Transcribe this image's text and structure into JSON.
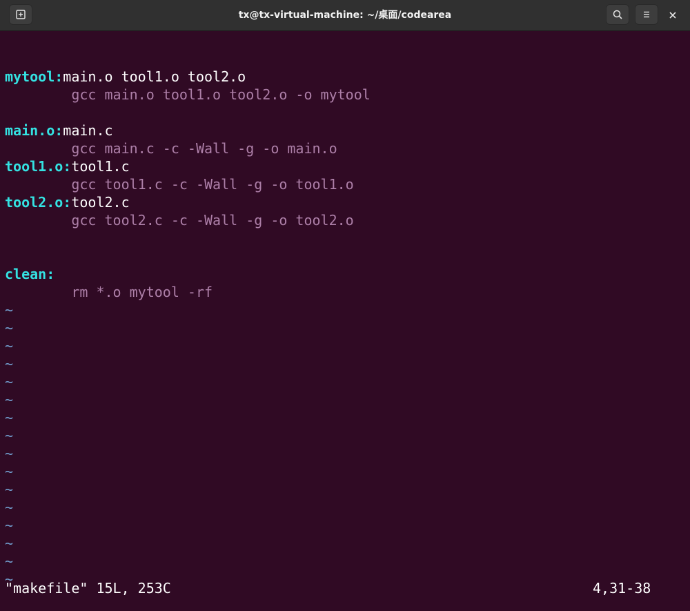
{
  "window": {
    "title": "tx@tx-virtual-machine: ~/桌面/codearea"
  },
  "icons": {
    "new_tab": "new-tab-icon",
    "search": "search-icon",
    "menu": "hamburger-menu-icon",
    "close": "close-icon"
  },
  "editor": {
    "lines": [
      {
        "target": "mytool:",
        "deps": "main.o tool1.o tool2.o"
      },
      {
        "cmd": "        gcc main.o tool1.o tool2.o -o mytool"
      },
      {
        "blank": ""
      },
      {
        "target": "main.o:",
        "deps": "main.c"
      },
      {
        "cmd": "        gcc main.c -c -Wall -g -o main.o"
      },
      {
        "target": "tool1.o:",
        "deps": "tool1.c"
      },
      {
        "cmd": "        gcc tool1.c -c -Wall -g -o tool1.o"
      },
      {
        "target": "tool2.o:",
        "deps": "tool2.c"
      },
      {
        "cmd": "        gcc tool2.c -c -Wall -g -o tool2.o"
      },
      {
        "blank": ""
      },
      {
        "blank": ""
      },
      {
        "target": "clean:",
        "deps": ""
      },
      {
        "cmd": "        rm *.o mytool -rf"
      }
    ],
    "tilde": "~",
    "status_left": "\"makefile\" 15L, 253C",
    "status_right": "4,31-38"
  },
  "colors": {
    "background": "#300a24",
    "target": "#34e2e2",
    "command": "#ad7fa8",
    "tilde": "#729fcf"
  }
}
